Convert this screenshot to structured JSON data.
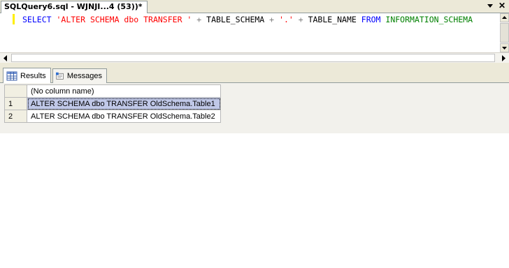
{
  "document_tab": {
    "title": "SQLQuery6.sql - WJNJI...4 (53))*"
  },
  "editor": {
    "tokens": [
      {
        "text": "SELECT",
        "cls": "kw"
      },
      {
        "text": " ",
        "cls": "id"
      },
      {
        "text": "'ALTER SCHEMA dbo TRANSFER '",
        "cls": "str"
      },
      {
        "text": " + ",
        "cls": "op"
      },
      {
        "text": "TABLE_SCHEMA",
        "cls": "id"
      },
      {
        "text": " + ",
        "cls": "op"
      },
      {
        "text": "'.'",
        "cls": "str"
      },
      {
        "text": " + ",
        "cls": "op"
      },
      {
        "text": "TABLE_NAME",
        "cls": "id"
      },
      {
        "text": " ",
        "cls": "id"
      },
      {
        "text": "FROM",
        "cls": "kw"
      },
      {
        "text": " ",
        "cls": "id"
      },
      {
        "text": "INFORMATION_SCHEMA",
        "cls": "obj"
      }
    ]
  },
  "results_tabs": {
    "results_label": "Results",
    "messages_label": "Messages"
  },
  "grid": {
    "column_header": "(No column name)",
    "rows": [
      {
        "num": "1",
        "value": "ALTER SCHEMA dbo TRANSFER OldSchema.Table1",
        "selected": true
      },
      {
        "num": "2",
        "value": "ALTER SCHEMA dbo TRANSFER OldSchema.Table2",
        "selected": false
      }
    ]
  },
  "colors": {
    "keyword": "#0000ff",
    "string": "#ff0000",
    "operator": "#808080",
    "system_object": "#008000",
    "selection": "#c0c8e8"
  },
  "icons": {
    "results_tab": "grid-icon",
    "messages_tab": "messages-icon",
    "tab_dropdown": "dropdown-arrow-icon",
    "tab_close": "close-icon"
  }
}
